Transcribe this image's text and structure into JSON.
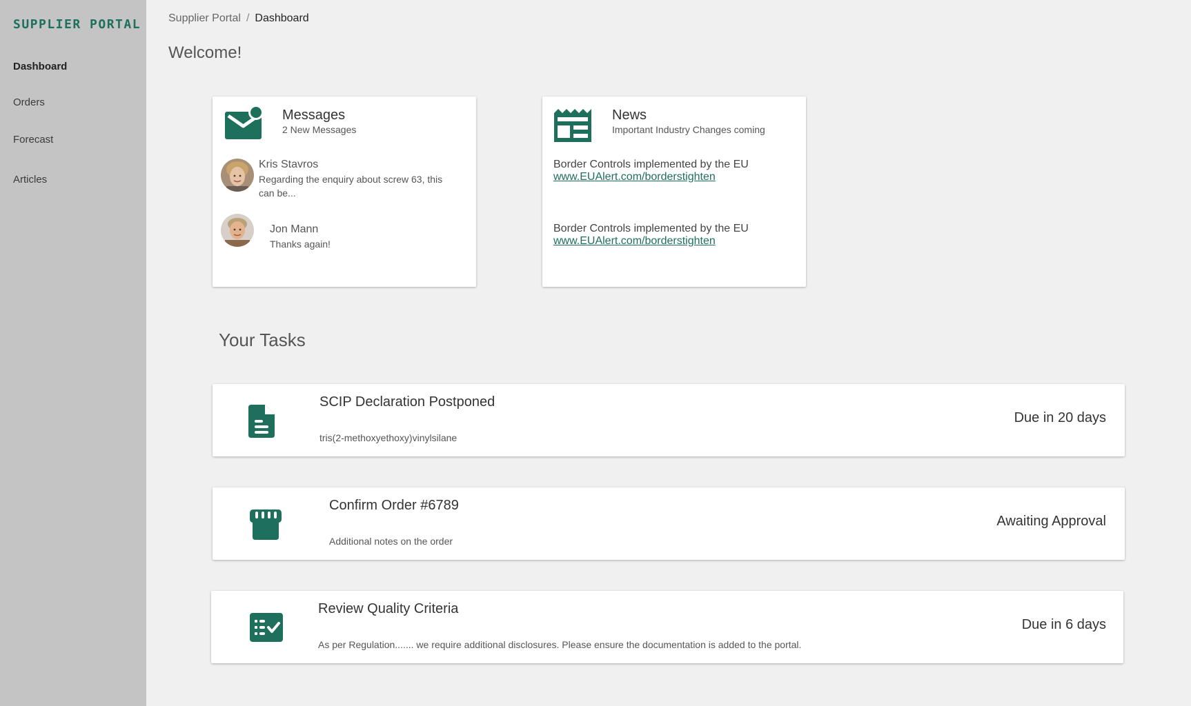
{
  "app": {
    "brand": "SUPPLIER PORTAL",
    "accent_color": "#1e6f5c"
  },
  "sidebar": {
    "items": [
      {
        "label": "Dashboard",
        "active": true
      },
      {
        "label": "Orders"
      },
      {
        "label": "Forecast"
      },
      {
        "label": "Articles"
      }
    ]
  },
  "breadcrumb": {
    "root": "Supplier Portal",
    "separator": "/",
    "current": "Dashboard"
  },
  "page": {
    "welcome": "Welcome!"
  },
  "messages_card": {
    "icon": "mail-notification-icon",
    "title": "Messages",
    "subtitle": "2 New Messages",
    "items": [
      {
        "name": "Kris Stavros",
        "text": "Regarding the enquiry about screw 63, this can be..."
      },
      {
        "name": "Jon Mann",
        "text": "Thanks again!"
      }
    ]
  },
  "news_card": {
    "icon": "newspaper-icon",
    "title": "News",
    "subtitle": "Important Industry Changes coming",
    "items": [
      {
        "headline": "Border Controls implemented by the EU",
        "link": "www.EUAlert.com/borderstighten"
      },
      {
        "headline": "Border Controls implemented by the EU",
        "link": "www.EUAlert.com/borderstighten"
      }
    ]
  },
  "tasks": {
    "title": "Your Tasks",
    "items": [
      {
        "icon": "document-icon",
        "title": "SCIP Declaration Postponed",
        "desc": "tris(2-methoxyethoxy)vinylsilane",
        "status": "Due in 20 days"
      },
      {
        "icon": "store-icon",
        "title": "Confirm Order #6789",
        "desc": "Additional notes on the order",
        "status": "Awaiting Approval"
      },
      {
        "icon": "checklist-icon",
        "title": "Review Quality Criteria",
        "desc": "As per Regulation....... we require additional disclosures. Please ensure the documentation is added to the portal.",
        "status": "Due in 6 days"
      }
    ]
  }
}
